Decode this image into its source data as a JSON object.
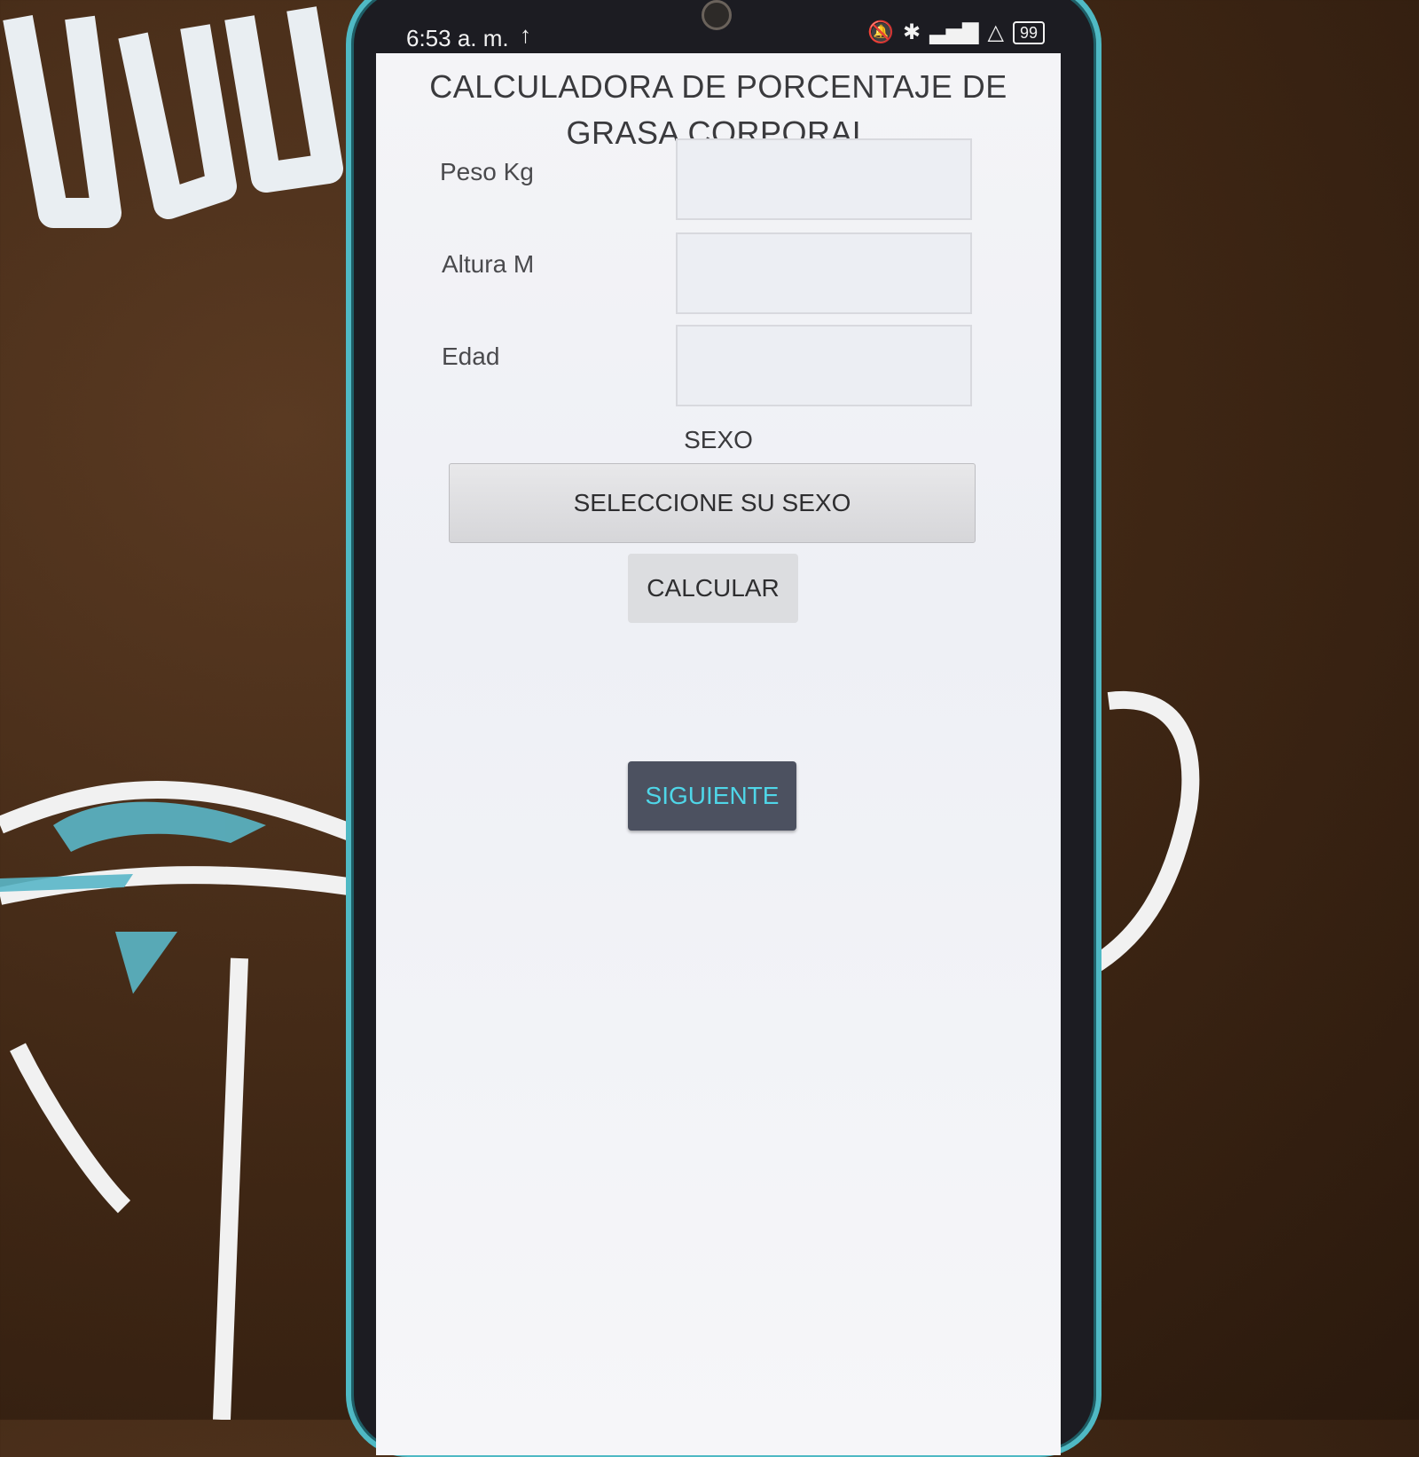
{
  "status_bar": {
    "time": "6:53 a. m.",
    "upload_icon": "↑",
    "battery": "99",
    "icons": [
      "bell-off-icon",
      "bluetooth-icon",
      "signal-icon",
      "data-icon",
      "battery-icon"
    ]
  },
  "app": {
    "title": "CALCULADORA DE PORCENTAJE DE GRASA CORPORAL",
    "fields": [
      {
        "label": "Peso Kg",
        "value": ""
      },
      {
        "label": "Altura M",
        "value": ""
      },
      {
        "label": "Edad",
        "value": ""
      }
    ],
    "sex_label": "SEXO",
    "sex_select_label": "SELECCIONE SU SEXO",
    "calculate_label": "CALCULAR",
    "next_label": "SIGUIENTE"
  },
  "colors": {
    "phone_frame": "#4fb9c4",
    "next_button_bg": "#4c5160",
    "next_button_text": "#4fd6e8"
  }
}
